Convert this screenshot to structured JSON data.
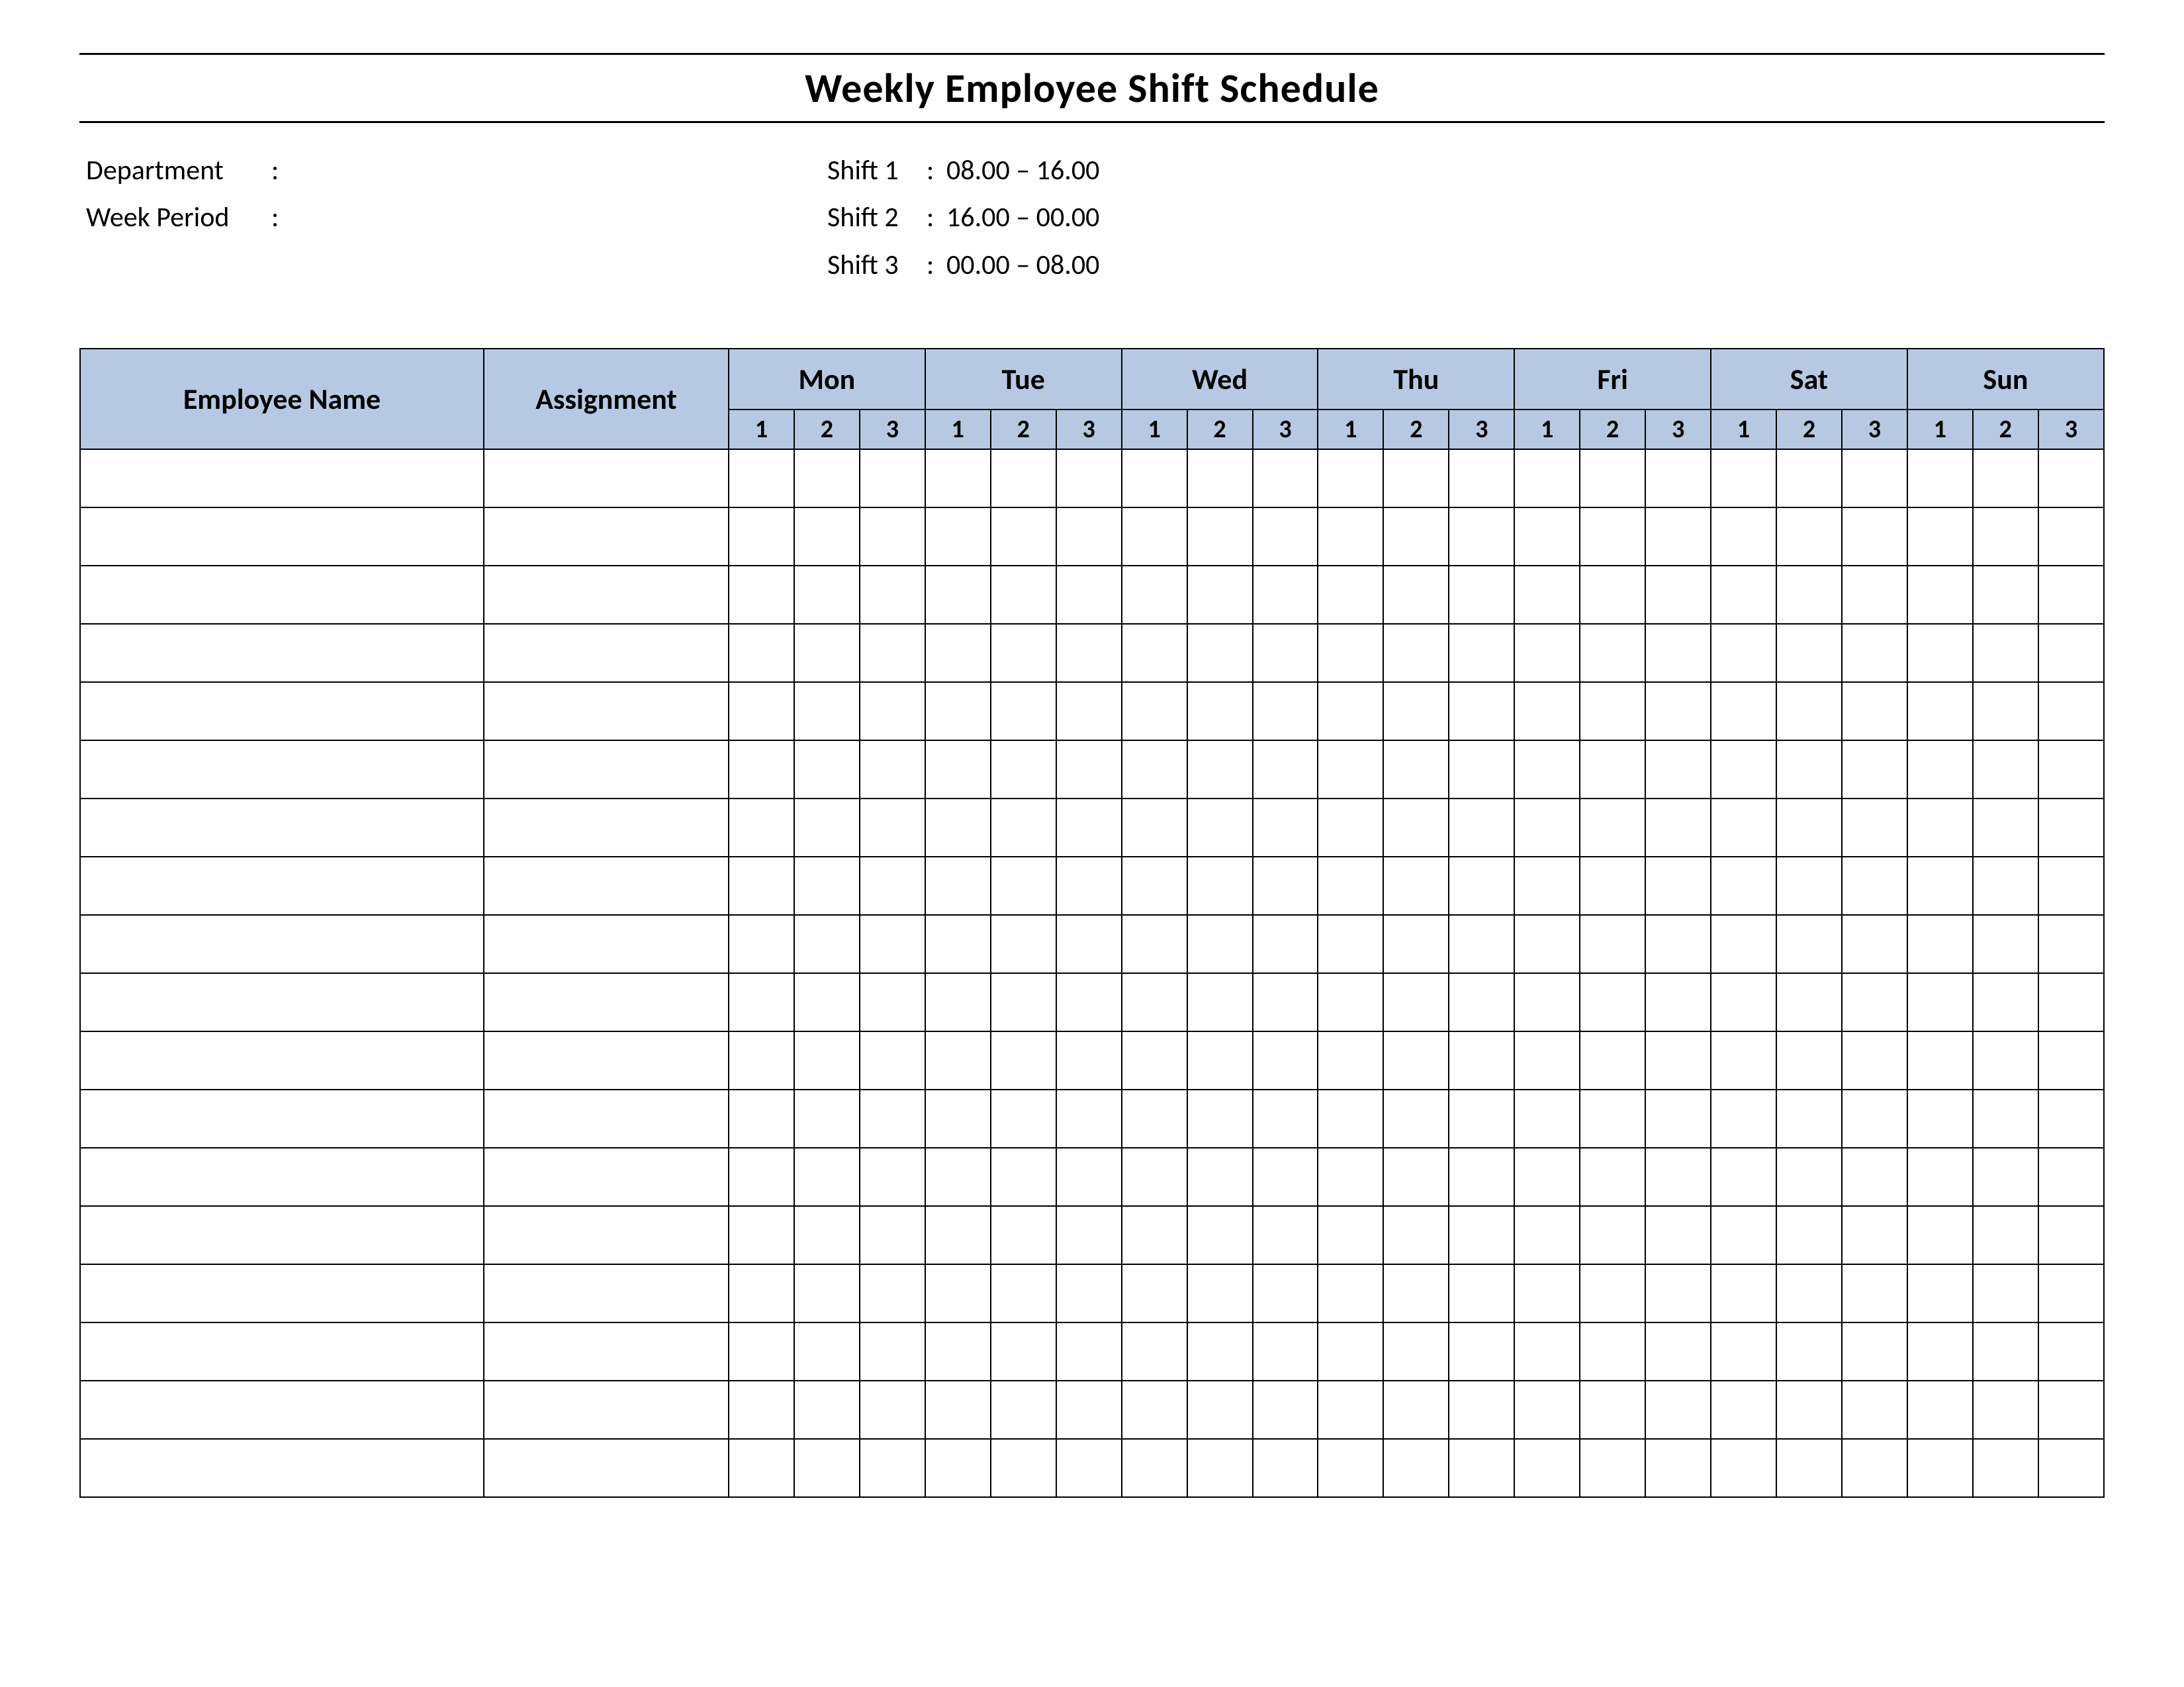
{
  "title": "Weekly Employee Shift Schedule",
  "meta": {
    "department_label": "Department",
    "department_value": "",
    "week_period_label": "Week  Period",
    "week_period_value": "",
    "shifts": [
      {
        "label": "Shift 1",
        "time": "08.00  – 16.00"
      },
      {
        "label": "Shift 2",
        "time": "16.00  – 00.00"
      },
      {
        "label": "Shift 3",
        "time": "00.00  – 08.00"
      }
    ]
  },
  "table": {
    "col_employee": "Employee Name",
    "col_assignment": "Assignment",
    "days": [
      "Mon",
      "Tue",
      "Wed",
      "Thu",
      "Fri",
      "Sat",
      "Sun"
    ],
    "shift_numbers": [
      "1",
      "2",
      "3"
    ],
    "row_count": 18
  }
}
